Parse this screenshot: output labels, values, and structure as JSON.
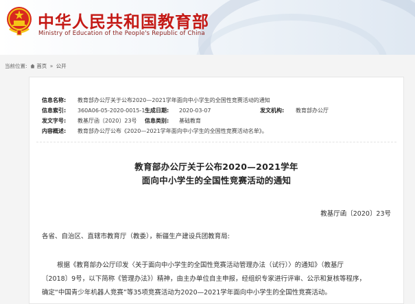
{
  "header": {
    "site_title": "中华人民共和国教育部",
    "site_subtitle": "Ministry of Education of the People's Republic of China",
    "emblem_icon": "national-emblem-icon",
    "brand_color": "#c41a16"
  },
  "breadcrumb": {
    "label": "当前位置:",
    "home": "首页",
    "sep": "»",
    "section": "公开"
  },
  "info": {
    "title_label": "信息名称:",
    "title_value": "教育部办公厅关于公布2020—2021学年面向中小学生的全国性竞赛活动的通知",
    "index_label": "信息索引:",
    "index_value": "360A06-05-2020-0015-1",
    "date_label": "生成日期:",
    "date_value": "2020-03-07",
    "issuer_label": "发文机构:",
    "issuer_value": "教育部办公厅",
    "docno_label": "发文字号:",
    "docno_value": "教基厅函〔2020〕23号",
    "category_label": "信息类别:",
    "category_value": "基础教育",
    "summary_label": "内容概述:",
    "summary_value": "教育部办公厅公布《2020—2021学年面向中小学生的全国性竞赛活动名单》。"
  },
  "document": {
    "title_line1": "教育部办公厅关于公布2020—2021学年",
    "title_line2": "面向中小学生的全国性竞赛活动的通知",
    "doc_number": "教基厅函〔2020〕23号",
    "salutation": "各省、自治区、直辖市教育厅（教委），新疆生产建设兵团教育局:",
    "body_line1": "根据《教育部办公厅印发〈关于面向中小学生的全国性竞赛活动管理办法（试行）〉的通知》（教基厅",
    "body_line2": "〔2018〕9号，以下简称《管理办法》）精神，由主办单位自主申报，经组织专家进行评审、公示和复核等程序，",
    "body_line3": "确定“中国青少年机器人竞赛”等35项竞赛活动为2020—2021学年面向中小学生的全国性竞赛活动。"
  }
}
